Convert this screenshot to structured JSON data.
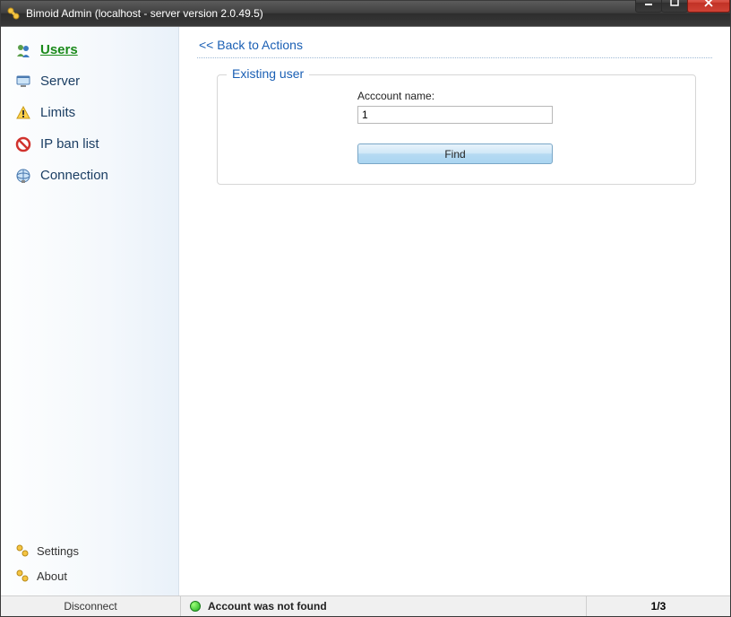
{
  "window": {
    "title": "Bimoid Admin (localhost - server version 2.0.49.5)"
  },
  "sidebar": {
    "items": [
      {
        "label": "Users"
      },
      {
        "label": "Server"
      },
      {
        "label": "Limits"
      },
      {
        "label": "IP ban list"
      },
      {
        "label": "Connection"
      }
    ],
    "bottom": [
      {
        "label": "Settings"
      },
      {
        "label": "About"
      }
    ]
  },
  "main": {
    "back_link": "<< Back to Actions",
    "group_title": "Existing user",
    "account_label": "Acccount name:",
    "account_value": "1",
    "find_button": "Find"
  },
  "status": {
    "disconnect": "Disconnect",
    "message": "Account was not found",
    "page": "1/3"
  }
}
